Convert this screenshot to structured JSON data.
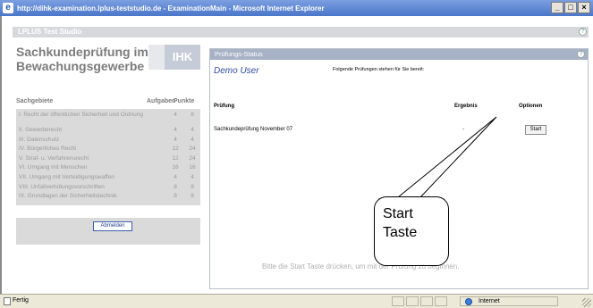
{
  "window": {
    "title": "http://dihk-examination.lplus-teststudio.de - ExaminationMain - Microsoft Internet Explorer",
    "buttons": [
      "_",
      "□",
      "×"
    ]
  },
  "app": {
    "name": "LPLUS Test Studio",
    "help_icon": "?"
  },
  "left_panel": {
    "heading": "Sachkundeprüfung im Bewachungsgewerbe",
    "logo": "IHK",
    "columns": {
      "subject": "Sachgebiete",
      "tasks": "Aufgaben",
      "points": "Punkte"
    },
    "subjects": [
      {
        "name": "I. Recht der öffentlichen Sicherheit und Ordnung",
        "tasks": "4",
        "points": "8"
      },
      {
        "name": "II. Gewerberecht",
        "tasks": "4",
        "points": "4"
      },
      {
        "name": "III. Datenschutz",
        "tasks": "4",
        "points": "4"
      },
      {
        "name": "IV. Bürgerliches Recht",
        "tasks": "12",
        "points": "24"
      },
      {
        "name": "V. Straf- u. Verfahrensrecht",
        "tasks": "12",
        "points": "24"
      },
      {
        "name": "VI. Umgang mit Menschen",
        "tasks": "16",
        "points": "16"
      },
      {
        "name": "VII. Umgang mit Verteidigungswaffen",
        "tasks": "4",
        "points": "4"
      },
      {
        "name": "VIII. Unfallverhütungsvorschriften",
        "tasks": "8",
        "points": "8"
      },
      {
        "name": "IX. Grundlagen der Sicherheitstechnik",
        "tasks": "8",
        "points": "8"
      }
    ],
    "logout_button": "Abmelden"
  },
  "right_panel": {
    "title": "Prüfungs-Status",
    "help_icon": "?",
    "user": "Demo User",
    "intro": "Folgende Prüfungen stehen für Sie bereit:",
    "columns": {
      "exam": "Prüfung",
      "result": "Ergebnis",
      "options": "Optionen"
    },
    "rows": [
      {
        "exam": "Sachkundeprüfung November 07",
        "result": "-",
        "action": "Start"
      }
    ],
    "footer_message": "Bitte die Start Taste drücken, um mit der Prüfung zu beginnen."
  },
  "callout": {
    "line1": "Start",
    "line2": "Taste"
  },
  "statusbar": {
    "status": "Fertig",
    "zone": "Internet"
  }
}
